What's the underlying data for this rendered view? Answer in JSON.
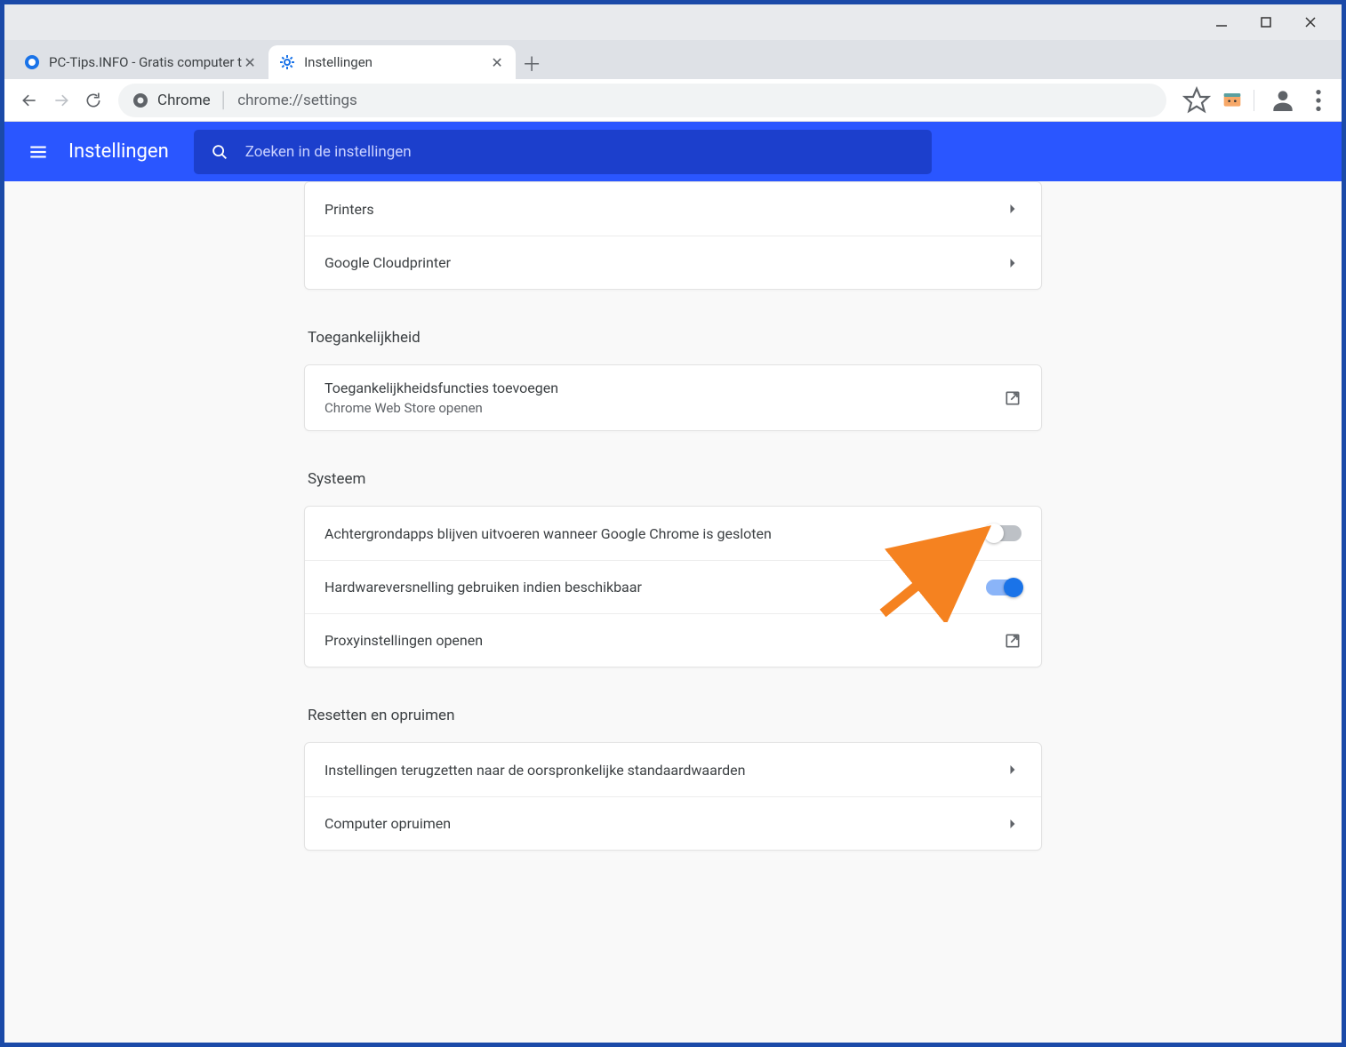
{
  "window": {
    "title_app": "Chrome"
  },
  "tabs": [
    {
      "title": "PC-Tips.INFO - Gratis computer t",
      "active": false
    },
    {
      "title": "Instellingen",
      "active": true
    }
  ],
  "toolbar": {
    "origin_label": "Chrome",
    "url_path": "chrome://settings"
  },
  "header": {
    "title": "Instellingen",
    "search_placeholder": "Zoeken in de instellingen"
  },
  "sections": {
    "print_card": {
      "rows": [
        {
          "label": "Printers"
        },
        {
          "label": "Google Cloudprinter"
        }
      ]
    },
    "accessibility": {
      "title": "Toegankelijkheid",
      "row": {
        "label": "Toegankelijkheidsfuncties toevoegen",
        "sublabel": "Chrome Web Store openen"
      }
    },
    "system": {
      "title": "Systeem",
      "rows": [
        {
          "label": "Achtergrondapps blijven uitvoeren wanneer Google Chrome is gesloten",
          "toggle": "off"
        },
        {
          "label": "Hardwareversnelling gebruiken indien beschikbaar",
          "toggle": "on"
        },
        {
          "label": "Proxyinstellingen openen",
          "external": true
        }
      ]
    },
    "reset": {
      "title": "Resetten en opruimen",
      "rows": [
        {
          "label": "Instellingen terugzetten naar de oorspronkelijke standaardwaarden"
        },
        {
          "label": "Computer opruimen"
        }
      ]
    }
  },
  "colors": {
    "accent": "#2a56ff",
    "toggle_on": "#1a73e8",
    "arrow": "#f58220"
  }
}
